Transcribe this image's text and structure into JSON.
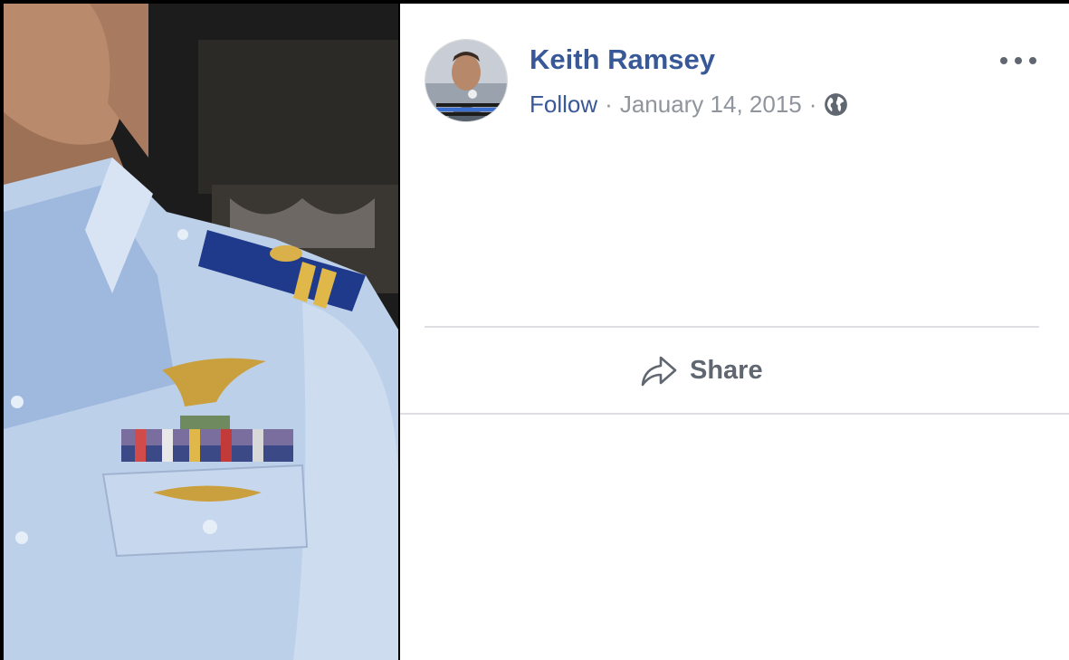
{
  "post": {
    "author_name": "Keith Ramsey",
    "follow_label": "Follow",
    "separator": "·",
    "timestamp": "January 14, 2015",
    "privacy_icon": "globe-icon",
    "more_icon": "more-options-icon",
    "share_label": "Share",
    "share_icon": "share-arrow-icon"
  },
  "colors": {
    "link_blue": "#385898",
    "meta_gray": "#90949c",
    "action_gray": "#606770",
    "divider": "#dddfe2"
  }
}
